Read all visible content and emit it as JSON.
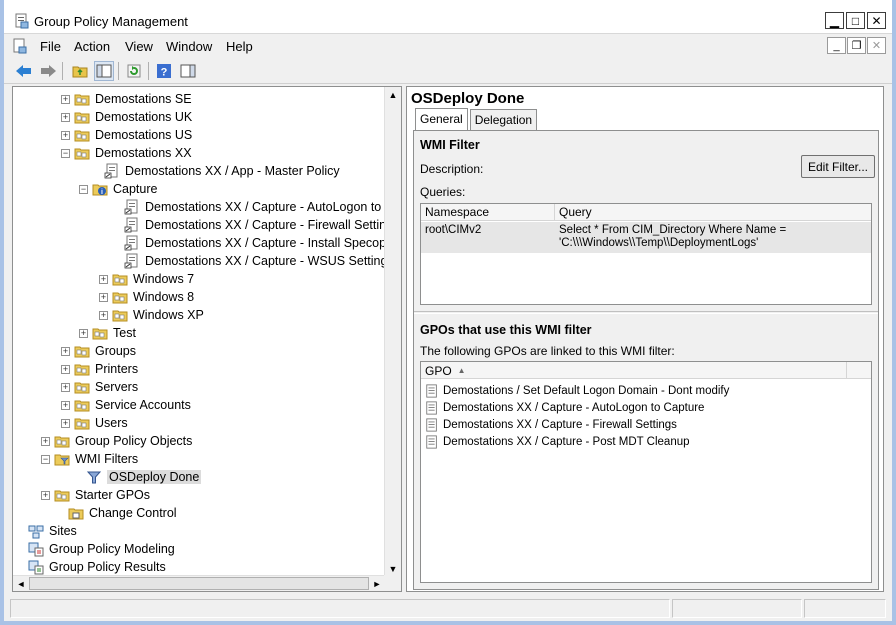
{
  "window": {
    "title": "Group Policy Management"
  },
  "menu": {
    "file": "File",
    "action": "Action",
    "view": "View",
    "window": "Window",
    "help": "Help"
  },
  "tree": {
    "nodes": [
      {
        "label": "Demostations SE",
        "icon": "folder-icon",
        "exp": "+"
      },
      {
        "label": "Demostations UK",
        "icon": "folder-icon",
        "exp": "+"
      },
      {
        "label": "Demostations US",
        "icon": "folder-icon",
        "exp": "+"
      },
      {
        "label": "Demostations XX",
        "icon": "folder-icon",
        "exp": "-"
      },
      {
        "label": "Demostations XX / App - Master Policy",
        "icon": "gpo-link-icon",
        "exp": ""
      },
      {
        "label": "Capture",
        "icon": "folder-blocked-icon",
        "exp": "-"
      },
      {
        "label": "Demostations XX / Capture - AutoLogon to Cap",
        "icon": "gpo-link-icon",
        "exp": ""
      },
      {
        "label": "Demostations XX / Capture - Firewall Settings",
        "icon": "gpo-link-icon",
        "exp": ""
      },
      {
        "label": "Demostations XX / Capture - Install Specops CSE",
        "icon": "gpo-link-icon",
        "exp": ""
      },
      {
        "label": "Demostations XX / Capture - WSUS Settings",
        "icon": "gpo-link-icon",
        "exp": ""
      },
      {
        "label": "Windows 7",
        "icon": "folder-icon",
        "exp": "+"
      },
      {
        "label": "Windows 8",
        "icon": "folder-icon",
        "exp": "+"
      },
      {
        "label": "Windows XP",
        "icon": "folder-icon",
        "exp": "+"
      },
      {
        "label": "Test",
        "icon": "folder-icon",
        "exp": "+"
      },
      {
        "label": "Groups",
        "icon": "folder-icon",
        "exp": "+"
      },
      {
        "label": "Printers",
        "icon": "folder-icon",
        "exp": "+"
      },
      {
        "label": "Servers",
        "icon": "folder-icon",
        "exp": "+"
      },
      {
        "label": "Service Accounts",
        "icon": "folder-icon",
        "exp": "+"
      },
      {
        "label": "Users",
        "icon": "folder-icon",
        "exp": "+"
      },
      {
        "label": "Group Policy Objects",
        "icon": "folder-icon",
        "exp": "+"
      },
      {
        "label": "WMI Filters",
        "icon": "wmi-folder-icon",
        "exp": "-"
      },
      {
        "label": "OSDeploy Done",
        "icon": "wmi-filter-icon",
        "exp": ""
      },
      {
        "label": "Starter GPOs",
        "icon": "folder-icon",
        "exp": "+"
      },
      {
        "label": "Change Control",
        "icon": "change-control-icon",
        "exp": ""
      },
      {
        "label": "Sites",
        "icon": "sites-icon",
        "exp": ""
      },
      {
        "label": "Group Policy Modeling",
        "icon": "modeling-icon",
        "exp": ""
      },
      {
        "label": "Group Policy Results",
        "icon": "results-icon",
        "exp": ""
      }
    ]
  },
  "detail": {
    "title": "OSDeploy Done",
    "tabs": [
      "General",
      "Delegation"
    ],
    "wmi_section": "WMI Filter",
    "description_label": "Description:",
    "edit_button": "Edit Filter...",
    "queries_label": "Queries:",
    "query_columns": [
      "Namespace",
      "Query"
    ],
    "query_rows": [
      {
        "namespace": "root\\CIMv2",
        "query": "Select * From CIM_Directory Where Name = 'C:\\\\\\Windows\\\\Temp\\\\DeploymentLogs'"
      }
    ],
    "gpos_section": "GPOs that use this WMI filter",
    "gpos_desc": "The following GPOs are linked to this WMI filter:",
    "gpo_column": "GPO",
    "gpo_rows": [
      "Demostations / Set Default Logon Domain - Dont modify",
      "Demostations XX / Capture - AutoLogon to Capture",
      "Demostations XX / Capture - Firewall Settings",
      "Demostations XX / Capture - Post MDT Cleanup"
    ]
  }
}
